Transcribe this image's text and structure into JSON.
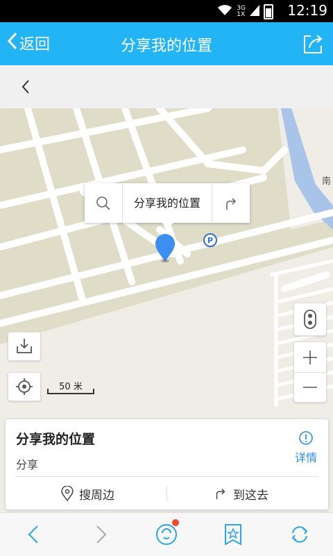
{
  "status_bar": {
    "time": "12:19",
    "network_top": "3G",
    "network_bottom": "1X"
  },
  "header": {
    "back_label": "返回",
    "title": "分享我的位置"
  },
  "map": {
    "popup_text": "分享我的位置",
    "scale_label": "50 米",
    "parking_symbol": "P",
    "edge_label": "南"
  },
  "card": {
    "title": "分享我的位置",
    "subtitle": "分享",
    "detail_label": "详情",
    "nearby_label": "搜周边",
    "route_label": "到这去"
  },
  "colors": {
    "accent": "#23b4f5",
    "link": "#2b8df0",
    "badge": "#f04a2a",
    "river": "#a8c4e8",
    "land": "#dfdcc8"
  },
  "icons": [
    "share-icon",
    "search-icon",
    "route-icon",
    "download-icon",
    "locate-icon",
    "traffic-icon",
    "zoom-in-icon",
    "zoom-out-icon",
    "info-icon",
    "location-icon",
    "prev-icon",
    "next-icon",
    "chat-icon",
    "bookmark-icon",
    "refresh-icon"
  ]
}
